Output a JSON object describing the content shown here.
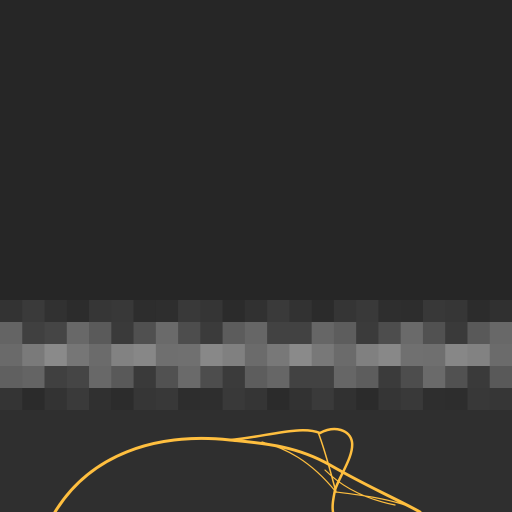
{
  "canvas": {
    "background_color": "#262626",
    "top_panel_color": "#262626",
    "bottom_panel_color": "#2f2f2f",
    "band_colors": {
      "dark": "#2b2b2b",
      "mid": "#3a3a3a",
      "light": "#6a6a6a",
      "highlight": "#8a8a8a"
    },
    "curve_color": "#ffbf3f"
  },
  "icons": {
    "curve": "bezier-curve-icon"
  }
}
